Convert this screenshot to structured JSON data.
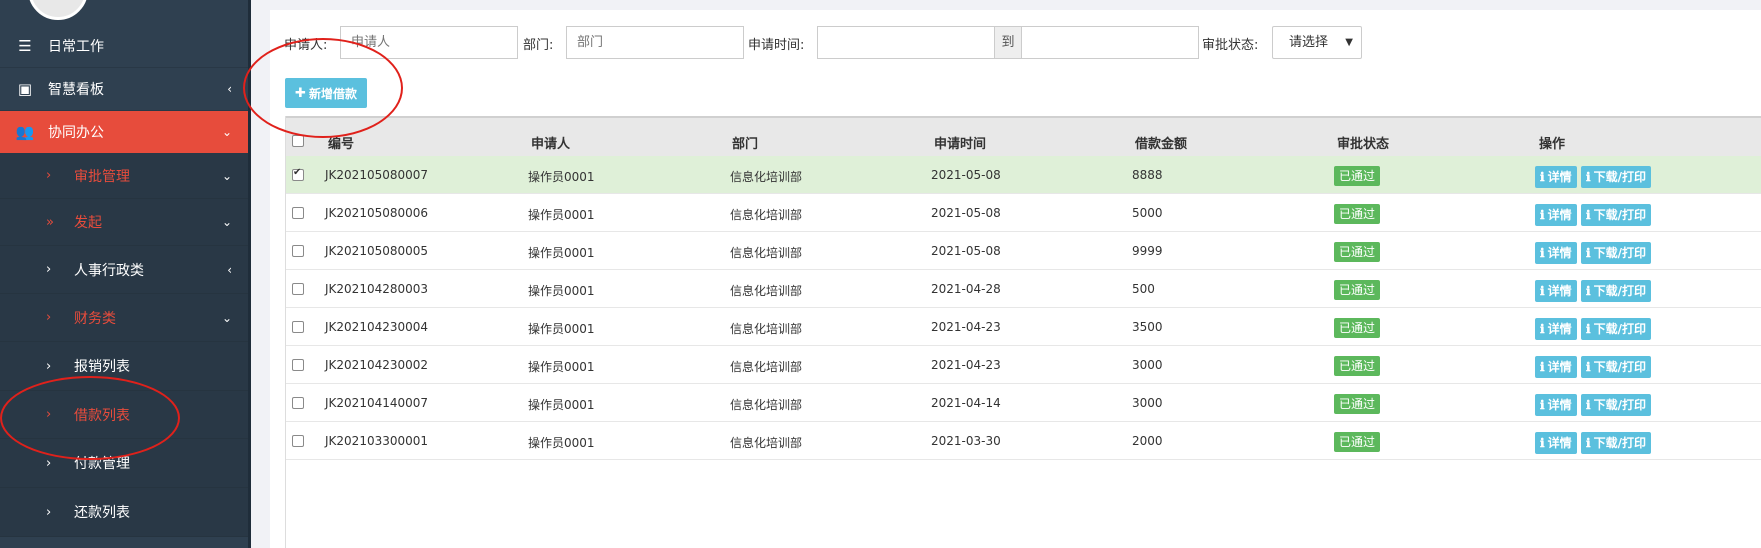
{
  "sidebar": {
    "items": [
      {
        "label": "日常工作",
        "icon": "list-icon"
      },
      {
        "label": "智慧看板",
        "icon": "dashboard-icon"
      },
      {
        "label": "协同办公",
        "icon": "users-icon"
      },
      {
        "label": "审批管理"
      },
      {
        "label": "发起"
      },
      {
        "label": "人事行政类"
      },
      {
        "label": "财务类"
      },
      {
        "label": "报销列表"
      },
      {
        "label": "借款列表"
      },
      {
        "label": "付款管理"
      },
      {
        "label": "还款列表"
      }
    ]
  },
  "filters": {
    "applicant_label": "申请人:",
    "applicant_placeholder": "申请人",
    "dept_label": "部门:",
    "dept_placeholder": "部门",
    "time_label": "申请时间:",
    "time_to": "到",
    "status_label": "审批状态:",
    "status_value": "请选择"
  },
  "toolbar": {
    "add_label": "新增借款"
  },
  "table": {
    "headers": [
      "编号",
      "申请人",
      "部门",
      "申请时间",
      "借款金额",
      "审批状态",
      "操作"
    ],
    "detail_label": "详情",
    "print_label": "下载/打印",
    "rows": [
      {
        "id": "JK202105080007",
        "applicant": "操作员0001",
        "dept": "信息化培训部",
        "date": "2021-05-08",
        "amount": "8888",
        "status": "已通过",
        "checked": true
      },
      {
        "id": "JK202105080006",
        "applicant": "操作员0001",
        "dept": "信息化培训部",
        "date": "2021-05-08",
        "amount": "5000",
        "status": "已通过",
        "checked": false
      },
      {
        "id": "JK202105080005",
        "applicant": "操作员0001",
        "dept": "信息化培训部",
        "date": "2021-05-08",
        "amount": "9999",
        "status": "已通过",
        "checked": false
      },
      {
        "id": "JK202104280003",
        "applicant": "操作员0001",
        "dept": "信息化培训部",
        "date": "2021-04-28",
        "amount": "500",
        "status": "已通过",
        "checked": false
      },
      {
        "id": "JK202104230004",
        "applicant": "操作员0001",
        "dept": "信息化培训部",
        "date": "2021-04-23",
        "amount": "3500",
        "status": "已通过",
        "checked": false
      },
      {
        "id": "JK202104230002",
        "applicant": "操作员0001",
        "dept": "信息化培训部",
        "date": "2021-04-23",
        "amount": "3000",
        "status": "已通过",
        "checked": false
      },
      {
        "id": "JK202104140007",
        "applicant": "操作员0001",
        "dept": "信息化培训部",
        "date": "2021-04-14",
        "amount": "3000",
        "status": "已通过",
        "checked": false
      },
      {
        "id": "JK202103300001",
        "applicant": "操作员0001",
        "dept": "信息化培训部",
        "date": "2021-03-30",
        "amount": "2000",
        "status": "已通过",
        "checked": false
      }
    ]
  },
  "colors": {
    "sidebar_bg": "#2f4050",
    "active_red": "#e74c3c",
    "info_blue": "#5bc0de",
    "success_green": "#5cb85c",
    "annotation_red": "#e0211b"
  }
}
